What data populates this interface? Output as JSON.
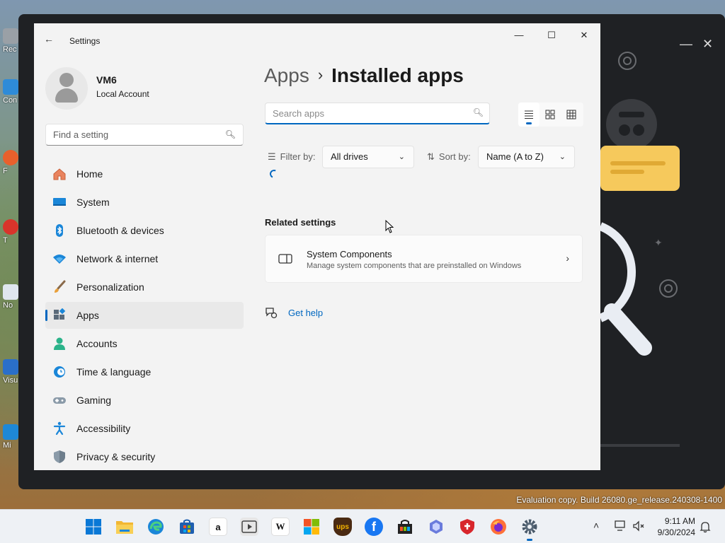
{
  "window": {
    "title": "Settings",
    "minimize": "—",
    "maximize": "☐",
    "close": "✕"
  },
  "account": {
    "name": "VM6",
    "type": "Local Account"
  },
  "find_setting": {
    "placeholder": "Find a setting"
  },
  "nav": [
    {
      "label": "Home",
      "icon": "home-icon"
    },
    {
      "label": "System",
      "icon": "monitor-icon"
    },
    {
      "label": "Bluetooth & devices",
      "icon": "bluetooth-icon"
    },
    {
      "label": "Network & internet",
      "icon": "wifi-icon"
    },
    {
      "label": "Personalization",
      "icon": "brush-icon"
    },
    {
      "label": "Apps",
      "icon": "apps-icon",
      "active": true
    },
    {
      "label": "Accounts",
      "icon": "person-icon"
    },
    {
      "label": "Time & language",
      "icon": "clock-globe-icon"
    },
    {
      "label": "Gaming",
      "icon": "gamepad-icon"
    },
    {
      "label": "Accessibility",
      "icon": "accessibility-icon"
    },
    {
      "label": "Privacy & security",
      "icon": "shield-icon"
    }
  ],
  "breadcrumb": {
    "parent": "Apps",
    "separator": "›",
    "current": "Installed apps"
  },
  "search_apps": {
    "placeholder": "Search apps"
  },
  "view_modes": [
    "list-view-icon",
    "tile-view-icon",
    "grid-view-icon"
  ],
  "filter": {
    "label": "Filter by:",
    "value": "All drives"
  },
  "sort": {
    "label": "Sort by:",
    "value": "Name (A to Z)"
  },
  "related": {
    "heading": "Related settings",
    "card_title": "System Components",
    "card_desc": "Manage system components that are preinstalled on Windows"
  },
  "help": {
    "label": "Get help"
  },
  "desktop": {
    "watermark": "Evaluation copy. Build 26080.ge_release.240308-1400",
    "icon_labels": [
      "Rec",
      "Con",
      "F",
      "T",
      "No",
      "Visu",
      "Mi"
    ]
  },
  "clock": {
    "time": "9:11 AM",
    "date": "9/30/2024"
  },
  "colors": {
    "accent": "#0067c0",
    "sidebar_bg": "#f3f3f3",
    "dark_app_bg": "#1f2124"
  },
  "taskbar": [
    {
      "name": "start-button",
      "icon": "windows-logo-icon"
    },
    {
      "name": "file-explorer",
      "icon": "folder-icon"
    },
    {
      "name": "edge",
      "icon": "edge-icon"
    },
    {
      "name": "microsoft-store",
      "icon": "store-icon"
    },
    {
      "name": "amazon",
      "icon": "amazon-icon",
      "text": "a"
    },
    {
      "name": "media-player",
      "icon": "film-icon"
    },
    {
      "name": "wikipedia",
      "icon": "wikipedia-icon",
      "text": "W"
    },
    {
      "name": "microsoft",
      "icon": "microsoft-logo-icon"
    },
    {
      "name": "ups",
      "icon": "ups-icon",
      "text": "ups"
    },
    {
      "name": "facebook",
      "icon": "facebook-icon",
      "text": "f"
    },
    {
      "name": "shopping",
      "icon": "shopping-bag-icon"
    },
    {
      "name": "copilot",
      "icon": "copilot-icon"
    },
    {
      "name": "security-shield",
      "icon": "red-shield-icon"
    },
    {
      "name": "firefox",
      "icon": "firefox-icon"
    },
    {
      "name": "settings",
      "icon": "gear-icon"
    }
  ]
}
